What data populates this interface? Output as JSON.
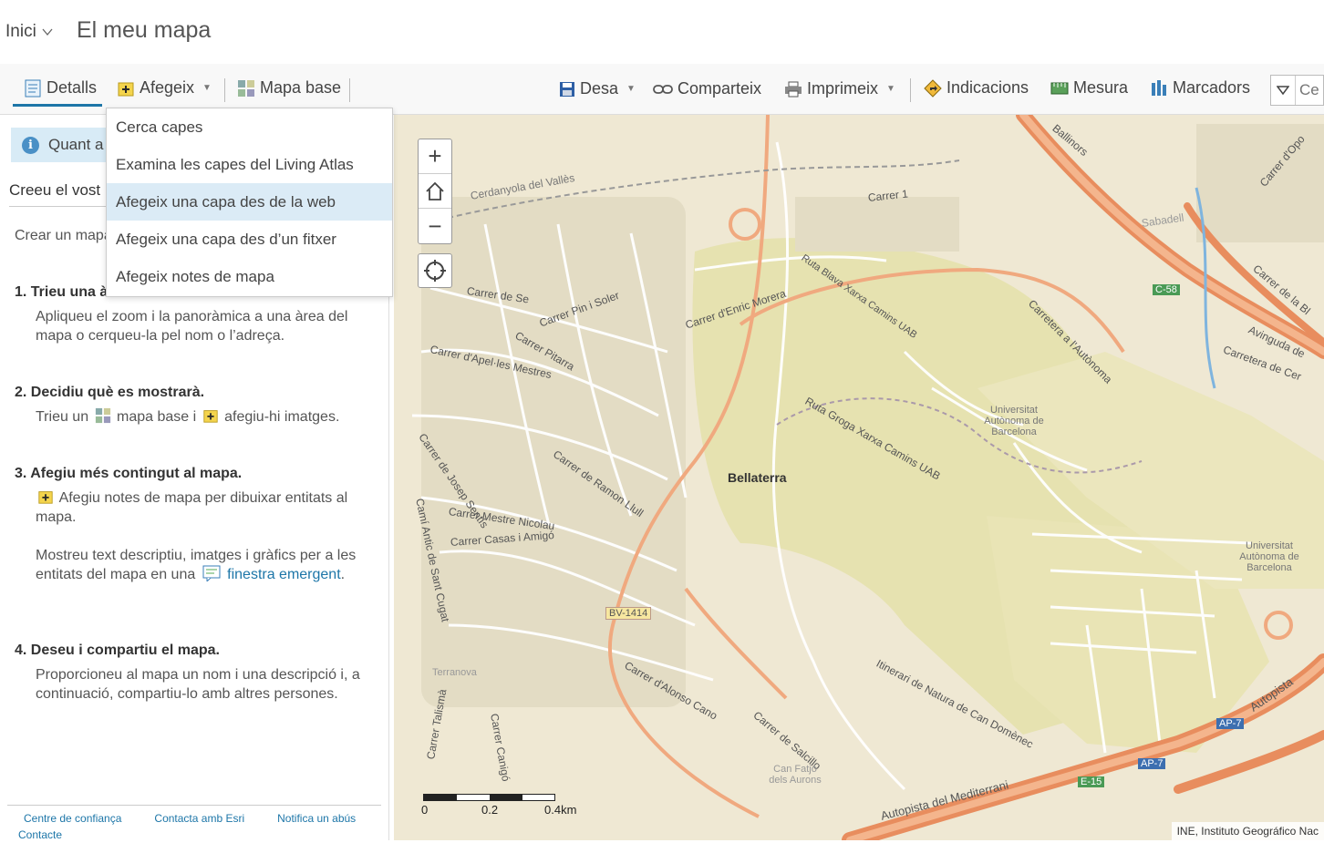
{
  "header": {
    "home_label": "Inici",
    "map_title": "El meu mapa"
  },
  "toolbar": {
    "details": "Detalls",
    "add": "Afegeix",
    "basemap": "Mapa base",
    "save": "Desa",
    "share": "Comparteix",
    "print": "Imprimeix",
    "directions": "Indicacions",
    "measure": "Mesura",
    "bookmarks": "Marcadors",
    "search_placeholder": "Ce"
  },
  "add_menu": {
    "items": [
      "Cerca capes",
      "Examina les capes del Living Atlas",
      "Afegeix una capa des de la web",
      "Afegeix una capa des d’un fitxer",
      "Afegeix notes de mapa"
    ],
    "highlighted_index": 2
  },
  "panel": {
    "banner": "Quant a",
    "intro_heading": "Creeu el vost",
    "intro_text": "Crear un mapa … aquests pass",
    "steps": [
      {
        "title": "1. Trieu una à",
        "body": "Apliqueu el zoom i la panoràmica a una àrea del mapa o cerqueu-la pel nom o l’adreça."
      },
      {
        "title": "2. Decidiu què es mostrarà.",
        "body_a": "Trieu un",
        "body_b": "mapa base i",
        "body_c": "afegiu-hi imatges."
      },
      {
        "title": "3. Afegiu més contingut al mapa.",
        "body_a": "Afegiu notes de mapa per dibuixar entitats al mapa.",
        "body_b": "Mostreu text descriptiu, imatges i gràfics per a les entitats del mapa en una",
        "link": "finestra emergent",
        "body_c": "."
      },
      {
        "title": "4. Deseu i compartiu el mapa.",
        "body": "Proporcioneu al mapa un nom i una descripció i, a continuació, compartiu-lo amb altres persones."
      }
    ],
    "footer": [
      "Centre de confiança",
      "Contacta amb Esri",
      "Notifica un abús",
      "Contacte"
    ]
  },
  "map": {
    "labels": {
      "bellaterra": "Bellaterra",
      "cerdanyola": "Cerdanyola del Vallès",
      "carrer1": "Carrer 1",
      "sabadell": "Sabadell",
      "carretera": "Carretera a l'Autònoma",
      "uab1": "Universitat Autònoma de Barcelona",
      "uab2": "Universitat Autònoma de Barcelona",
      "ruta_groga": "Ruta Groga Xarxa Camins UAB",
      "ruta_blava": "Ruta Blava Xarxa Camins UAB",
      "carrer_enric": "Carrer d'Enric Morera",
      "carrer_pin": "Carrer Pin i Soler",
      "carrer_apel": "Carrer d'Apel·les Mestres",
      "carrer_sentis": "Carrer de Josep Sentís",
      "carrer_ramon": "Carrer de Ramon Llull",
      "carrer_mestre": "Carrer Mestre Nicolau",
      "carrer_casas": "Carrer Casas i Amigó",
      "cami_antic": "Camí Antic de Sant Cugat",
      "bv1414": "BV-1414",
      "carrer_alonso": "Carrer d'Alonso Cano",
      "carrer_salcillo": "Carrer de Salcillo",
      "itinerari": "Itinerari de Natura de Can Domènec",
      "autopista": "Autopista del Mediterrani",
      "autopista2": "Autopista",
      "ap7a": "AP-7",
      "ap7b": "AP-7",
      "c58": "C-58",
      "e15": "E-15",
      "can_fatjo": "Can Fatjó dels Aurons",
      "terranova": "Terranova",
      "carrer_canigo": "Carrer Canigó",
      "carrer_talisma": "Carrer Talismà",
      "avinguda": "Avinguda de",
      "carretera_cer": "Carretera de Cer",
      "carrer_opo": "Carrer d'Opo",
      "carrer_bl": "Carrer de la Bl",
      "ballinors": "Ballinors",
      "carrer_dese": "Carrer de Se",
      "carrer_pitarra": "Carrer Pitarra"
    },
    "scale": {
      "s0": "0",
      "s1": "0.2",
      "s2": "0.4km"
    },
    "attribution": "INE, Instituto Geográfico Nac"
  }
}
